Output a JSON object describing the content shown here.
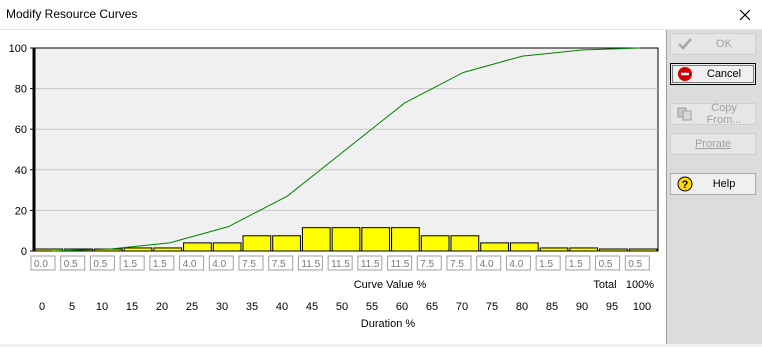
{
  "window": {
    "title": "Modify Resource Curves"
  },
  "buttons": {
    "ok": "OK",
    "cancel": "Cancel",
    "copy_from": "Copy From...",
    "prorate": "Prorate",
    "help": "Help"
  },
  "labels": {
    "curve_value": "Curve Value %",
    "total": "Total",
    "total_value": "100%",
    "duration": "Duration %"
  },
  "colors": {
    "bar_fill": "#ffff00",
    "curve": "#008000",
    "plot_bg": "#f0f0f0"
  },
  "chart_data": {
    "type": "bar",
    "y_ticks": [
      "100",
      "80",
      "60",
      "40",
      "20",
      "0"
    ],
    "ylim": [
      0,
      100
    ],
    "curve_values": [
      "0.0",
      "0.5",
      "0.5",
      "1.5",
      "1.5",
      "4.0",
      "4.0",
      "7.5",
      "7.5",
      "11.5",
      "11.5",
      "11.5",
      "11.5",
      "7.5",
      "7.5",
      "4.0",
      "4.0",
      "1.5",
      "1.5",
      "0.5",
      "0.5"
    ],
    "values": [
      0.0,
      0.5,
      0.5,
      1.5,
      1.5,
      4.0,
      4.0,
      7.5,
      7.5,
      11.5,
      11.5,
      11.5,
      11.5,
      7.5,
      7.5,
      4.0,
      4.0,
      1.5,
      1.5,
      0.5,
      0.5
    ],
    "duration_ticks": [
      "0",
      "5",
      "10",
      "15",
      "20",
      "25",
      "30",
      "35",
      "40",
      "45",
      "50",
      "55",
      "60",
      "65",
      "70",
      "75",
      "80",
      "85",
      "90",
      "95",
      "100"
    ],
    "cumulative": [
      0,
      0.5,
      1,
      2.5,
      4,
      8,
      12,
      19.5,
      27,
      38.5,
      50,
      61.5,
      73,
      80.5,
      88,
      92,
      96,
      97.5,
      99,
      99.5,
      100
    ],
    "grid": true
  }
}
